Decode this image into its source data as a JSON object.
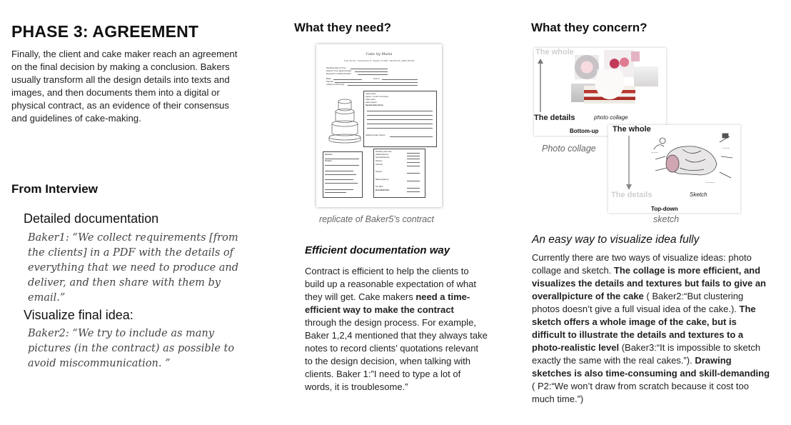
{
  "left": {
    "title": "PHASE 3: AGREEMENT",
    "intro": "Finally, the client and cake maker reach an agreement on the final decision by making a conclusion. Bakers usually transform all the design details into texts and images, and then documents them into a digital or physical contract, as an evidence of their consensus and guidelines of cake-making.",
    "interview_heading": "From Interview",
    "sections": [
      {
        "heading": "Detailed documentation",
        "quote": "Baker1: “We collect requirements [from the clients] in a PDF with the details of everything that we need to produce and deliver, and then share with them by email.”"
      },
      {
        "heading": "Visualize final idea:",
        "quote": "Baker2: “We try to include as many pictures (in the contract) as possible to avoid miscommunication. ”"
      }
    ]
  },
  "middle": {
    "heading": "What they need?",
    "contract": {
      "brand": "Cake by Maria",
      "address": "2 Sun Tax Ave · 10 Pemberton St · Windsor, CA 2000 · 000-00-0179 +1(867) 000 000",
      "fields": [
        "Wedding Date & Time:",
        "Delivery Time (approximate):",
        "Reception Location/Contact:",
        "Bride:",
        "Groom:",
        "Parents:",
        "Address & Phone(s):"
      ],
      "design_fields": [
        "Cake design:",
        "Approx. number of servings:",
        "Cake colors:",
        "Cake toppers:",
        "Special feature/form",
        "Additional cake / flavors:"
      ],
      "pay_fields": [
        "Services",
        "Flowers",
        "Wedding cake total:",
        "Additional/extra:",
        "Specialty/flowers:",
        "Delivery:",
        "Subtotal:",
        "Deposit:",
        "Balance/paid by:",
        "Tax (8%):",
        "BALANCE DUE:"
      ]
    },
    "caption": "replicate of Baker5’s contract",
    "subheading": "Efficient documentation way",
    "body": {
      "t1": "Contract is efficient to help the clients to build up a reasonable expectation of what they will get. Cake makers ",
      "b1": "need a time-efficient way to make the contract",
      "t2": " through the design process. For example, Baker 1,2,4 mentioned that they always take notes to record clients’ quotations relevant to the design decision, when talking with clients. Baker 1:”I need to type a lot of words, it is troublesome.”"
    }
  },
  "right": {
    "heading": "What they concern?",
    "panel1": {
      "top_label": "The whole",
      "bottom_label": "The details",
      "inner_caption": "photo collage",
      "bottom_caption": "Bottom-up"
    },
    "panel1_caption": "Photo collage",
    "panel2": {
      "top_label": "The whole",
      "bottom_label": "The details",
      "inner_caption": "Sketch",
      "bottom_caption": "Top-down"
    },
    "panel2_caption": "sketch",
    "subheading": "An easy way to visualize idea fully",
    "body": {
      "t1": "Currently there are two ways of visualize ideas: photo collage and sketch. ",
      "b1": "The collage is more efficient, and visualizes the details and textures but fails to give an overallpicture of the cake",
      "t2": " ( Baker2:“But clustering photos doesn’t give a full visual idea of the cake.). ",
      "b2": "The sketch offers a whole image of the cake, but is difficult to illustrate the details and textures to a photo-realistic level",
      "t3": " (Baker3:“It is impossible to sketch exactly the same with the real cakes.”). ",
      "b3": "Drawing sketches is also time-consuming and skill-demanding",
      "t4": " ( P2:“We won’t draw from scratch because it cost too much time.”)"
    }
  }
}
